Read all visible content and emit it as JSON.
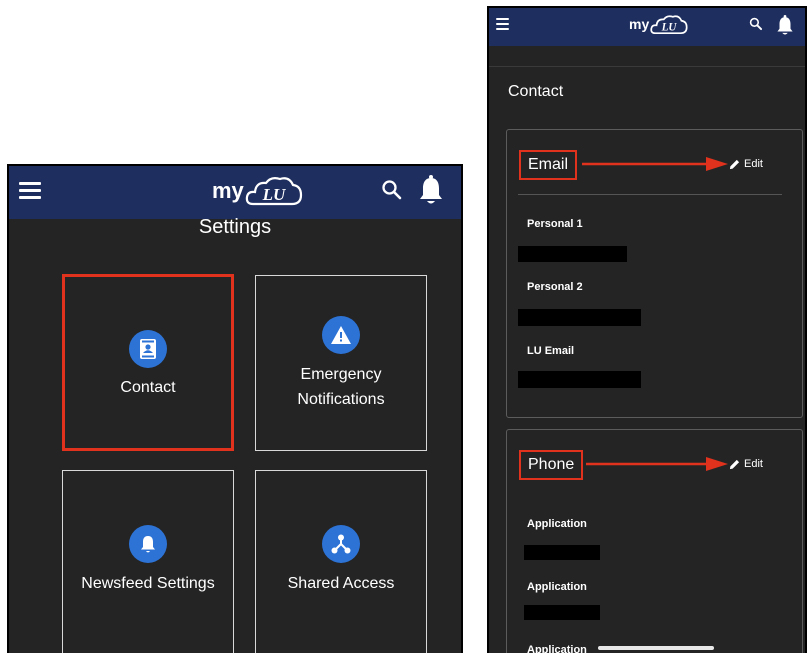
{
  "left_screen": {
    "header": {
      "logo_prefix": "my",
      "logo_mark": "LU",
      "icons": [
        "menu-icon",
        "search-icon",
        "bell-icon"
      ]
    },
    "title": "Settings",
    "tiles": [
      {
        "label": "Contact",
        "icon": "contact-card-icon",
        "highlighted": true
      },
      {
        "label_line1": "Emergency",
        "label_line2": "Notifications",
        "icon": "warning-icon"
      },
      {
        "label": "Newsfeed Settings",
        "icon": "bell-icon"
      },
      {
        "label": "Shared Access",
        "icon": "share-icon"
      }
    ]
  },
  "right_screen": {
    "header": {
      "logo_prefix": "my",
      "logo_mark": "LU",
      "icons": [
        "menu-icon",
        "search-icon",
        "bell-icon"
      ]
    },
    "title": "Contact",
    "email_section": {
      "label": "Email",
      "edit_label": "Edit",
      "fields": [
        "Personal 1",
        "Personal 2",
        "LU Email"
      ]
    },
    "phone_section": {
      "label": "Phone",
      "edit_label": "Edit",
      "fields": [
        "Application",
        "Application",
        "Application"
      ]
    }
  },
  "colors": {
    "header_blue": "#1e2e5f",
    "background": "#242424",
    "highlight_red": "#e0321c",
    "icon_blue": "#2d73d6"
  }
}
